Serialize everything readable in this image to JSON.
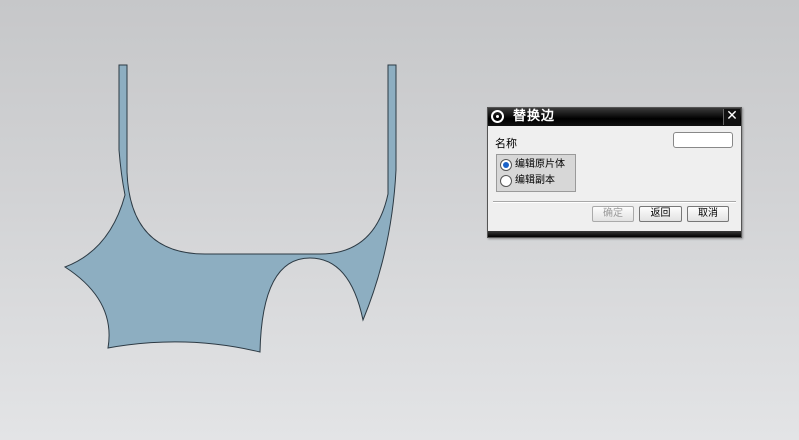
{
  "dialog": {
    "title": "替换边",
    "icon": "gear-icon",
    "close_glyph": "✕",
    "name_label": "名称",
    "name_value": "",
    "radio_options": [
      {
        "label": "编辑原片体",
        "checked": true
      },
      {
        "label": "编辑副本",
        "checked": false
      }
    ],
    "buttons": {
      "ok_label": "确定",
      "back_label": "返回",
      "cancel_label": "取消"
    }
  },
  "model": {
    "fill_color": "#8daec1",
    "stroke_color": "#2c3a44"
  }
}
